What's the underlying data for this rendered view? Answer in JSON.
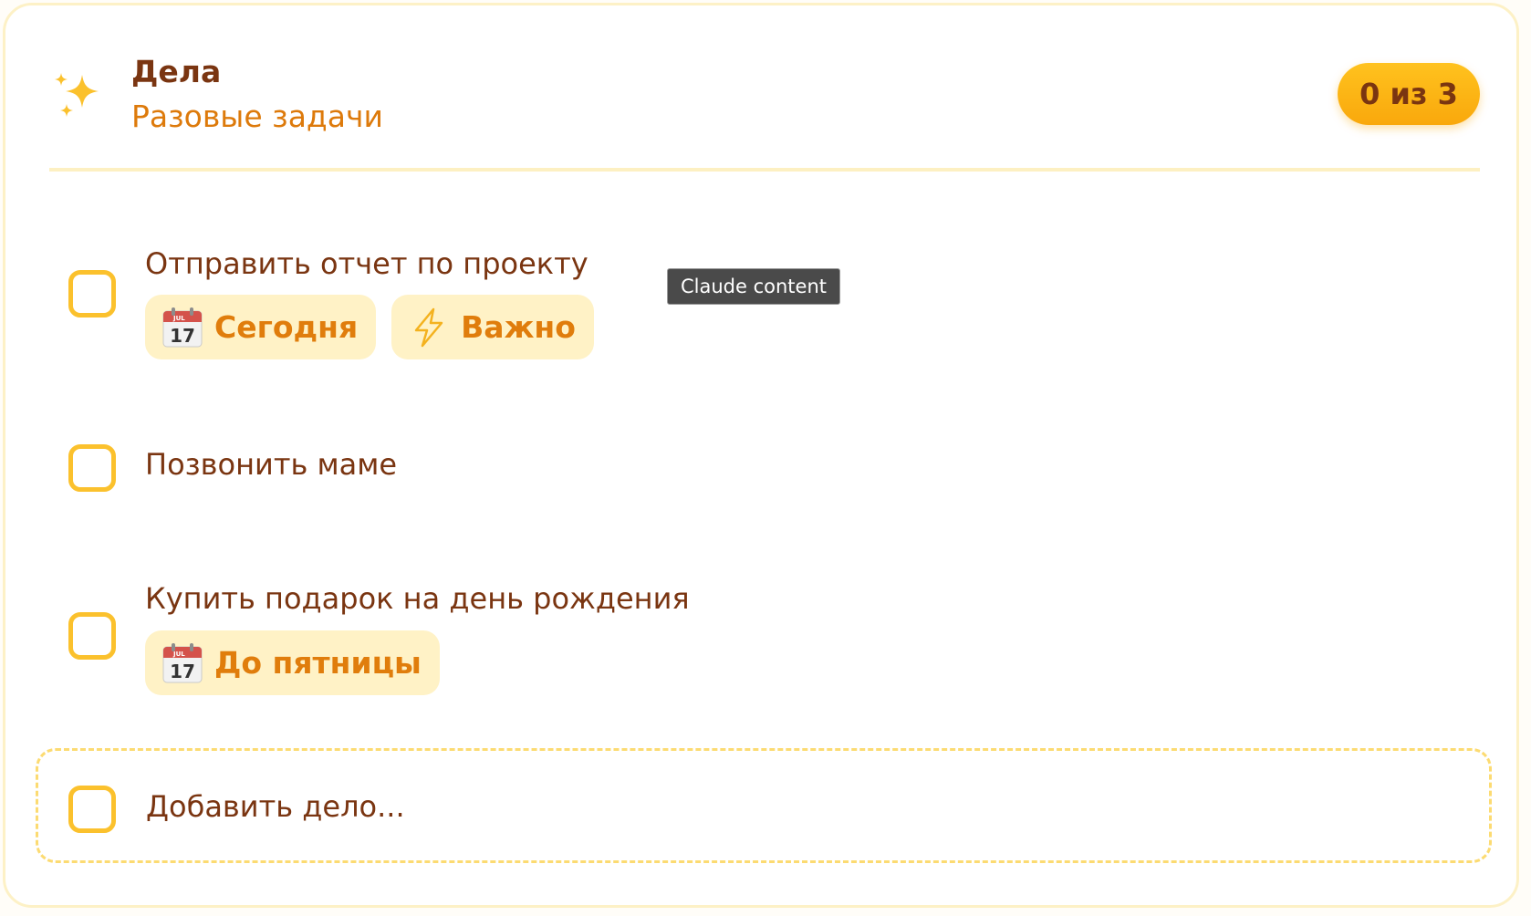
{
  "header": {
    "title": "Дела",
    "subtitle": "Разовые задачи",
    "counter": "0 из 3",
    "icon": "sparkle-icon"
  },
  "tasks": [
    {
      "text": "Отправить отчет по проекту",
      "done": false,
      "tags": [
        {
          "icon": "calendar-icon",
          "label": "Сегодня"
        },
        {
          "icon": "lightning-icon",
          "label": "Важно"
        }
      ]
    },
    {
      "text": "Позвонить маме",
      "done": false,
      "tags": []
    },
    {
      "text": "Купить подарок на день рождения",
      "done": false,
      "tags": [
        {
          "icon": "calendar-icon",
          "label": "До пятницы"
        }
      ]
    }
  ],
  "add_task": {
    "placeholder": "Добавить дело..."
  },
  "tooltip": {
    "text": "Claude content"
  },
  "calendar_icon": {
    "month": "JUL",
    "day": "17"
  },
  "colors": {
    "accent": "#fbc12d",
    "title": "#7a3511",
    "subtitle": "#dd7a0b",
    "tag_background": "#fff2c6",
    "tag_text": "#e07d0c"
  }
}
